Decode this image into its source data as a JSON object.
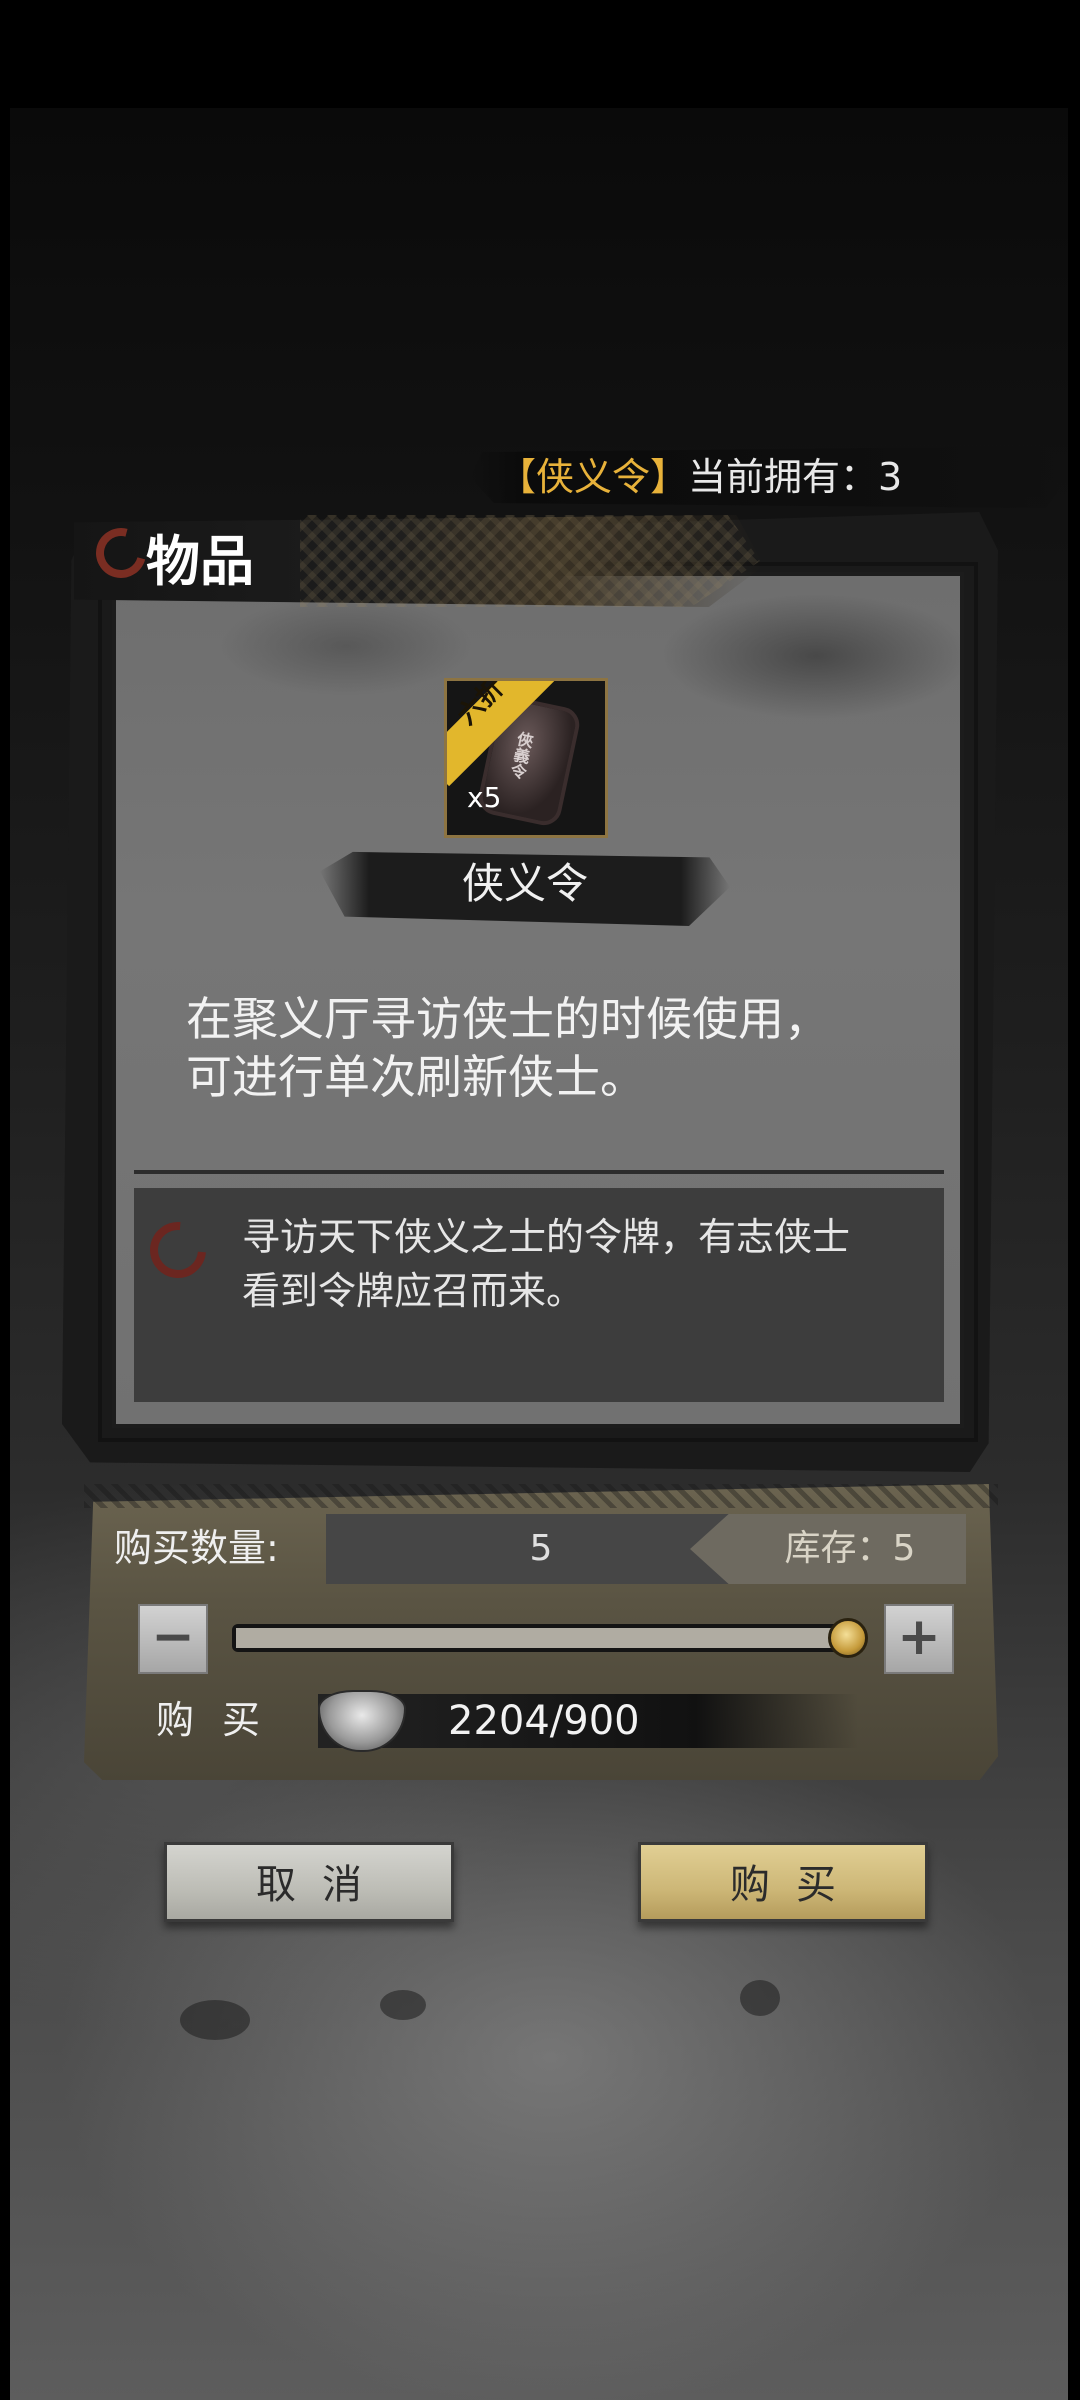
{
  "owned": {
    "item_bracketed": "【侠义令】",
    "label": "当前拥有：",
    "count": "3"
  },
  "panel": {
    "title": "物品"
  },
  "item": {
    "discount_badge": "六折",
    "quantity_badge": "x5",
    "token_engraving": "俠義令",
    "name": "侠义令",
    "description_line1": "在聚义厅寻访侠士的时候使用，",
    "description_line2": "可进行单次刷新侠士。",
    "lore_line1": "寻访天下侠义之士的令牌，有志侠士",
    "lore_line2": "看到令牌应召而来。"
  },
  "purchase": {
    "quantity_label": "购买数量:",
    "quantity_value": "5",
    "stock_label": "库存：5",
    "minus_label": "−",
    "plus_label": "+",
    "slider_fraction": 1.0,
    "buy_label": "购买",
    "price_text": "2204/900"
  },
  "buttons": {
    "cancel_label": "取消",
    "buy_label": "购买"
  },
  "colors": {
    "accent_gold": "#e8b23a",
    "buy_button": "#cdb777",
    "cancel_button": "#bdbdb6"
  },
  "icons": {
    "panel_icon": "swirl-icon",
    "lore_icon": "swirl-icon",
    "currency_icon": "silver-ingot-icon"
  }
}
